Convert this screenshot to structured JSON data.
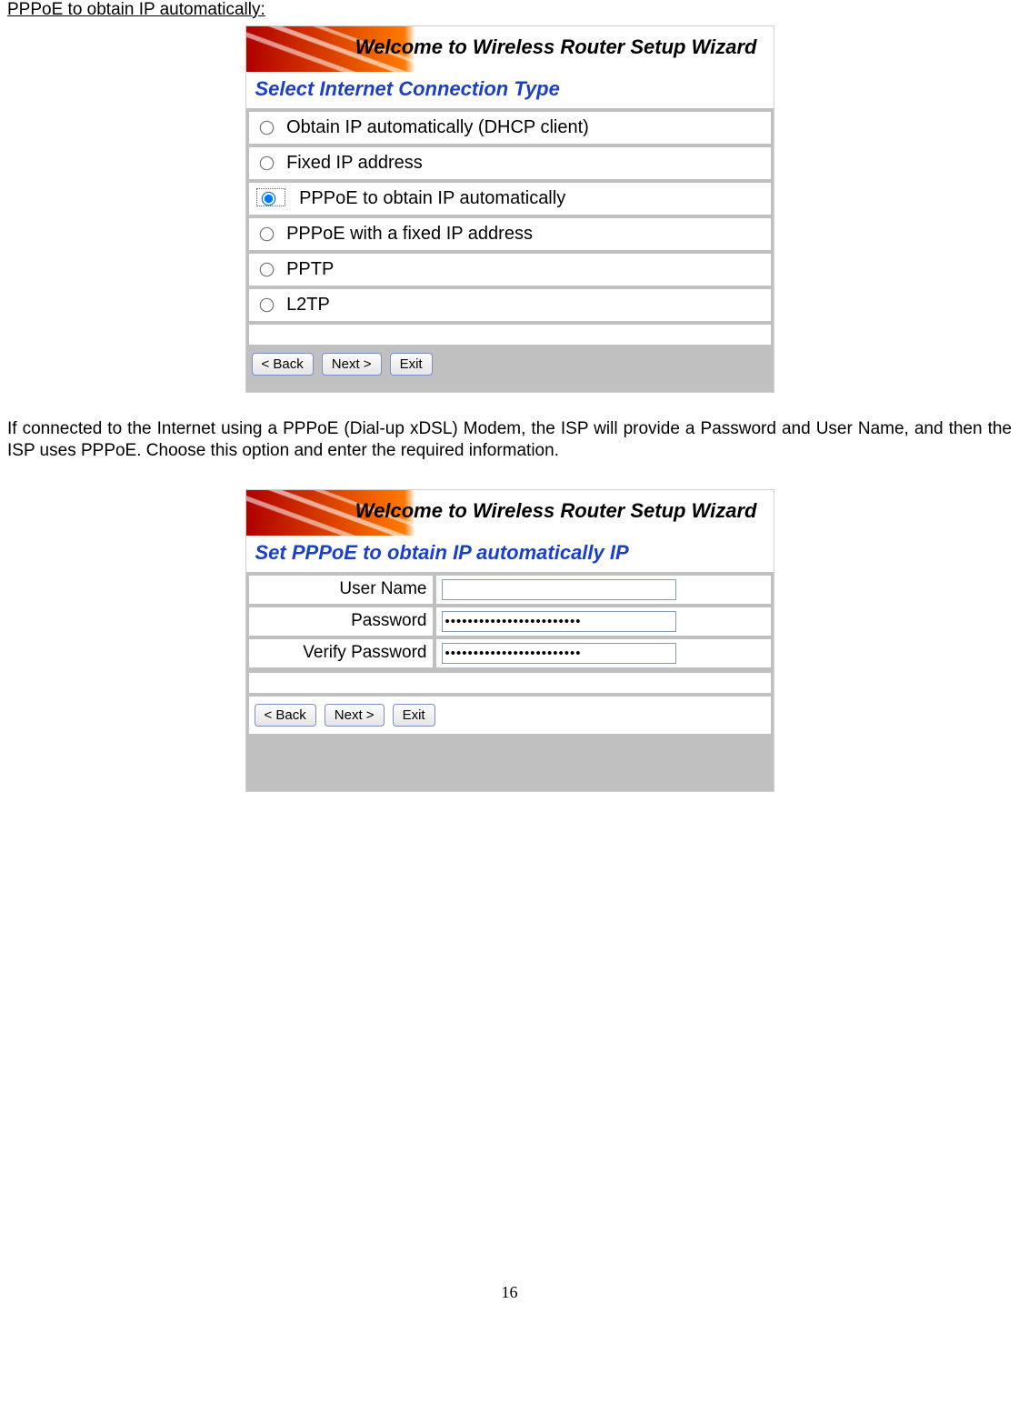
{
  "section_title": "PPPoE to obtain IP automatically:",
  "banner_title": "Welcome to Wireless Router Setup Wizard",
  "wizard1": {
    "header": "Select Internet Connection Type",
    "options": [
      "Obtain IP automatically (DHCP client)",
      "Fixed IP address",
      "PPPoE to obtain IP automatically",
      "PPPoE with a fixed IP address",
      "PPTP",
      "L2TP"
    ],
    "selected_index": 2,
    "buttons": {
      "back": "< Back",
      "next": "Next >",
      "exit": "Exit"
    }
  },
  "paragraph": "If connected to the Internet using a PPPoE (Dial-up xDSL) Modem, the ISP will provide a Password and User Name, and then the ISP uses PPPoE. Choose this option and enter the required information.",
  "wizard2": {
    "header": "Set PPPoE to obtain IP automatically IP",
    "fields": {
      "username_label": "User Name",
      "username_value": "",
      "password_label": "Password",
      "password_value": "••••••••••••••••••••••••",
      "verify_label": "Verify Password",
      "verify_value": "••••••••••••••••••••••••"
    },
    "buttons": {
      "back": "< Back",
      "next": "Next >",
      "exit": "Exit"
    }
  },
  "page_number": "16"
}
